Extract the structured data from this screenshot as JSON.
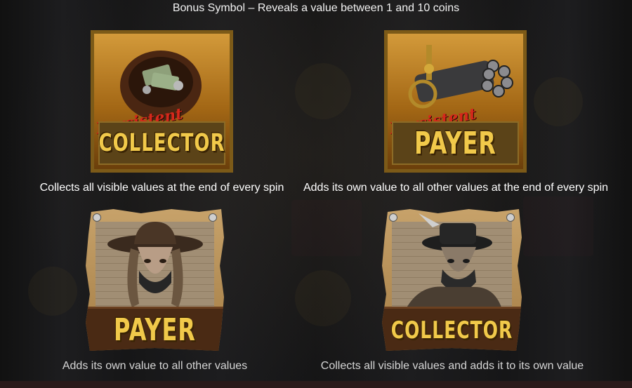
{
  "title": "Bonus Symbol – Reveals a value between 1 and 10 coins",
  "symbols": [
    {
      "badge": "Persistent",
      "word": "COLLECTOR",
      "caption": "Collects all visible values at the end of every spin",
      "icon": "money-bag-icon"
    },
    {
      "badge": "Persistent",
      "word": "PAYER",
      "caption": "Adds its own value to all other values at the end of every spin",
      "icon": "gatling-gun-icon"
    },
    {
      "word": "PAYER",
      "caption": "Adds its own value to all other values",
      "icon": "cowgirl-bandit-icon"
    },
    {
      "word": "COLLECTOR",
      "caption": "Collects all visible values and adds it to its own value",
      "icon": "cowboy-bandit-icon"
    }
  ],
  "colors": {
    "gold": "#f1c94a",
    "frame": "#7c5a18",
    "script_red": "#d5281b",
    "background": "#151516"
  }
}
